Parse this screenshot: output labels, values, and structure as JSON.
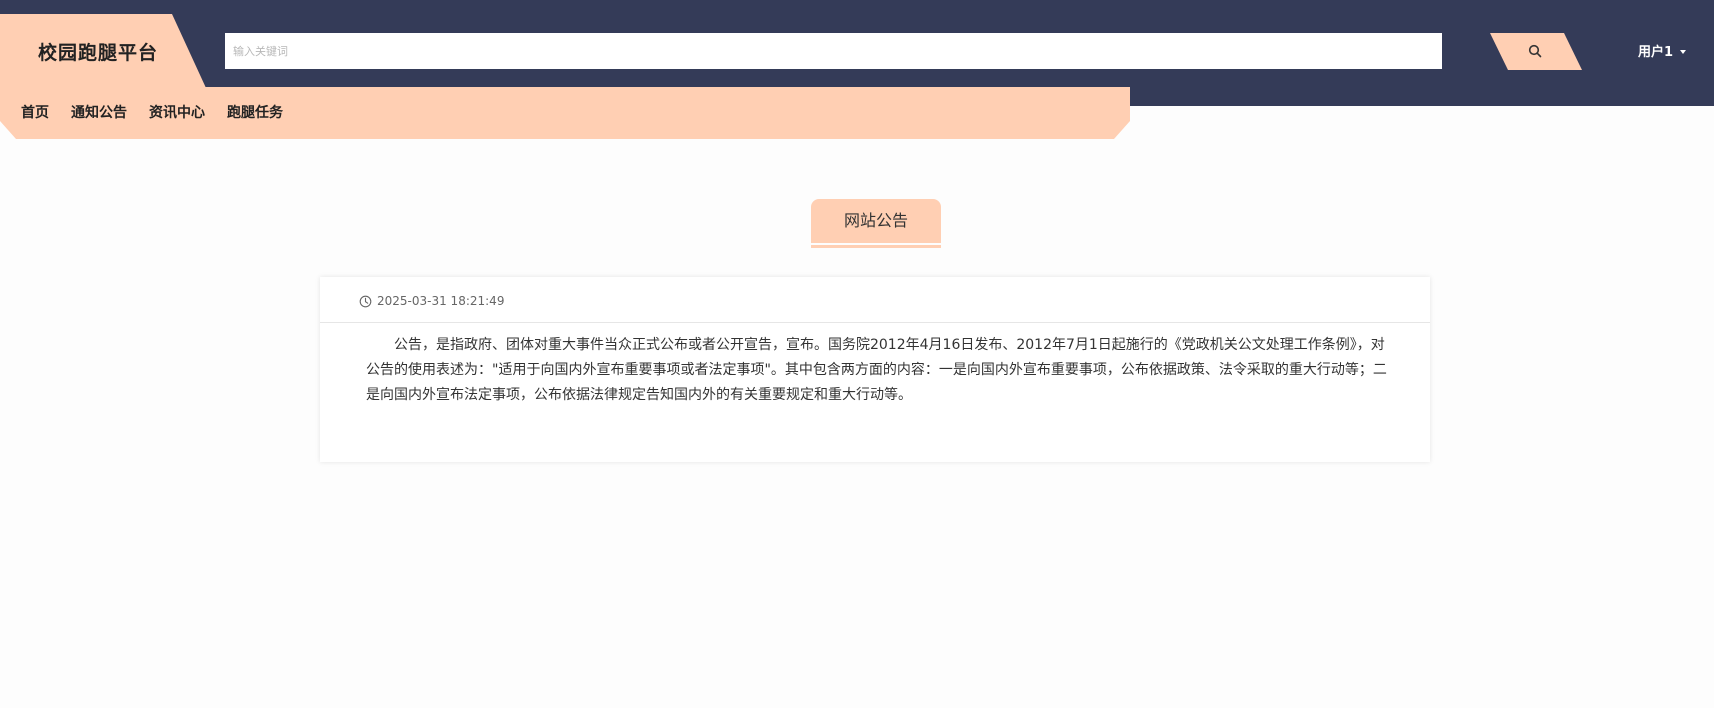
{
  "brand": {
    "title": "校园跑腿平台"
  },
  "search": {
    "placeholder": "输入关键词",
    "icon": "search-icon"
  },
  "user": {
    "name": "用户1"
  },
  "nav": {
    "items": [
      {
        "label": "首页"
      },
      {
        "label": "通知公告"
      },
      {
        "label": "资讯中心"
      },
      {
        "label": "跑腿任务"
      }
    ]
  },
  "section": {
    "title": "网站公告"
  },
  "notice": {
    "time": "2025-03-31 18:21:49",
    "content": "公告，是指政府、团体对重大事件当众正式公布或者公开宣告，宣布。国务院2012年4月16日发布、2012年7月1日起施行的《党政机关公文处理工作条例》，对公告的使用表述为：\"适用于向国内外宣布重要事项或者法定事项\"。其中包含两方面的内容：一是向国内外宣布重要事项，公布依据政策、法令采取的重大行动等；二是向国内外宣布法定事项，公布依据法律规定告知国内外的有关重要规定和重大行动等。"
  },
  "colors": {
    "header_bg": "#343b58",
    "accent": "#ffcfb3",
    "page_bg": "#fdfdfd"
  }
}
